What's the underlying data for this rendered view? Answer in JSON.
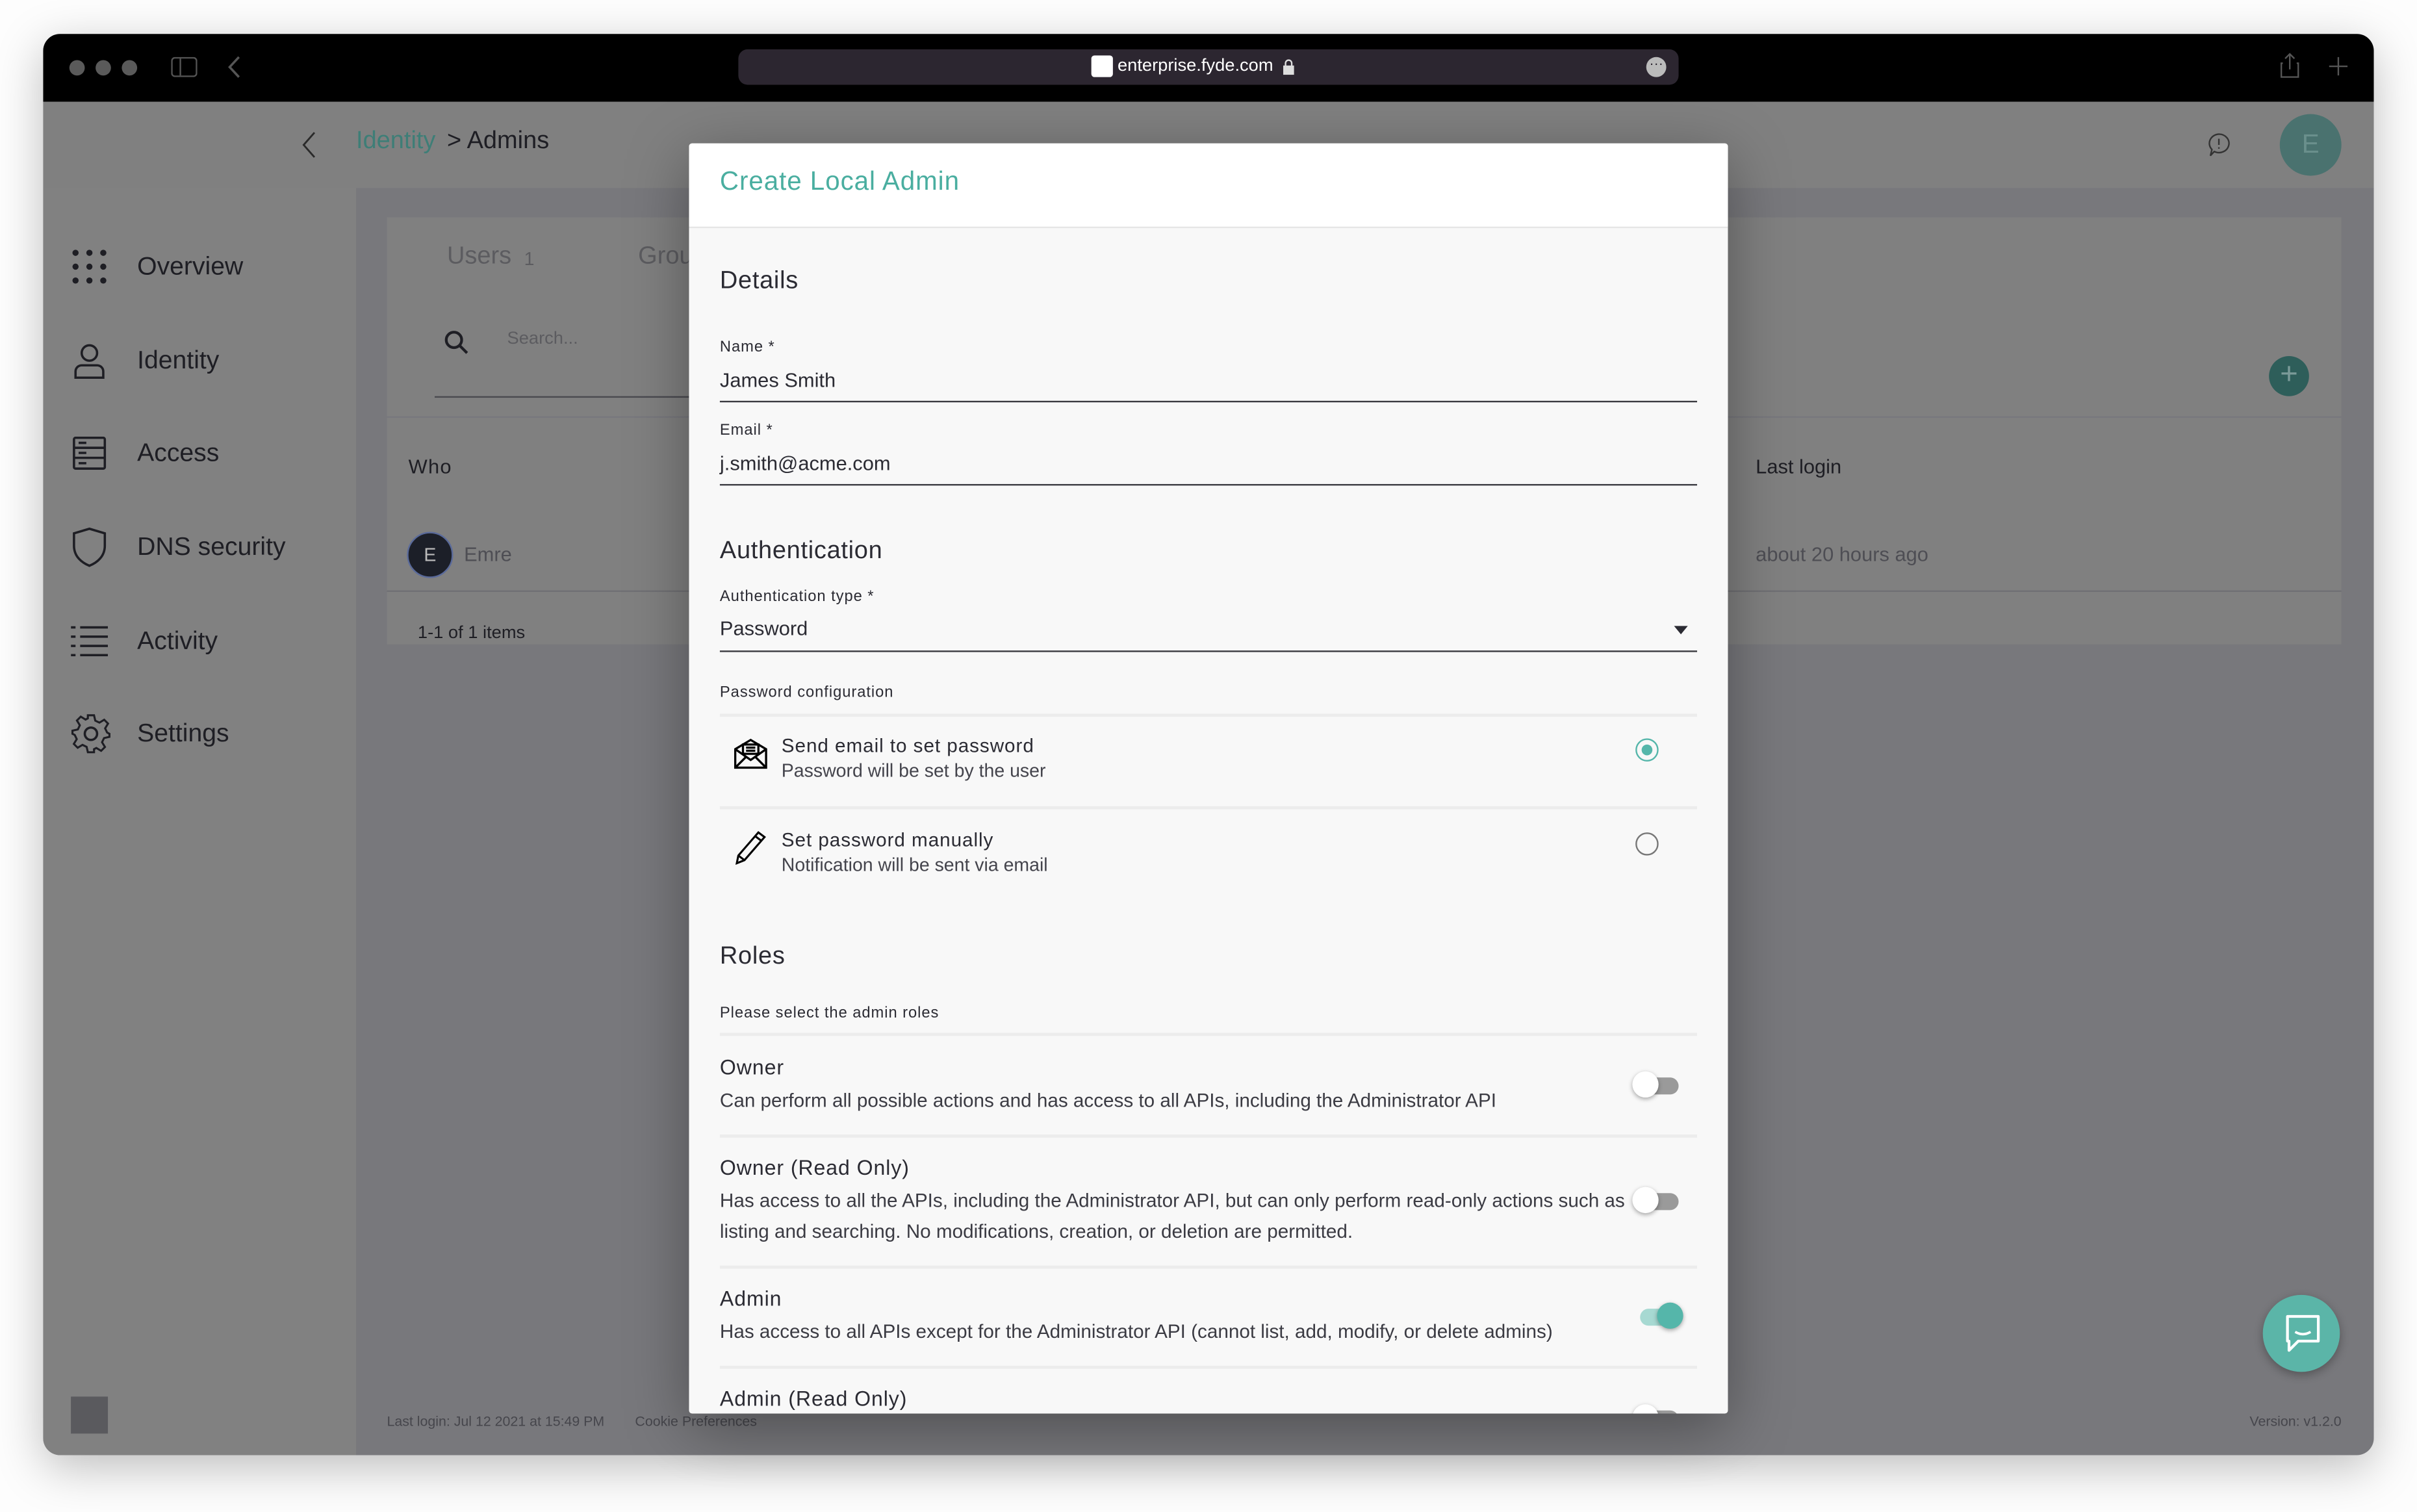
{
  "browser": {
    "url": "enterprise.fyde.com",
    "icons": [
      "traffic-lights",
      "sidebar-toggle-icon",
      "back-chevron-icon",
      "lock-icon",
      "more-icon",
      "share-icon",
      "new-tab-icon"
    ]
  },
  "header": {
    "breadcrumb_parent": "Identity",
    "breadcrumb_current": "> Admins",
    "avatar_initial": "E"
  },
  "sidebar": {
    "items": [
      {
        "label": "Overview",
        "icon": "grid-icon"
      },
      {
        "label": "Identity",
        "icon": "user-icon"
      },
      {
        "label": "Access",
        "icon": "server-icon"
      },
      {
        "label": "DNS security",
        "icon": "shield-icon"
      },
      {
        "label": "Activity",
        "icon": "list-icon"
      },
      {
        "label": "Settings",
        "icon": "gear-icon"
      }
    ]
  },
  "main": {
    "tabs": [
      {
        "label": "Users",
        "count": "1"
      },
      {
        "label": "Grou"
      }
    ],
    "search_placeholder": "Search...",
    "columns": [
      "Who",
      "Last login"
    ],
    "rows": [
      {
        "initial": "E",
        "name": "Emre",
        "last_login": "about 20 hours ago"
      }
    ],
    "pagination": "1-1 of 1 items"
  },
  "footer": {
    "last_login": "Last login: Jul 12 2021 at 15:49 PM",
    "cookie": "Cookie Preferences",
    "version": "Version: v1.2.0"
  },
  "modal": {
    "title": "Create Local Admin",
    "details_heading": "Details",
    "name_label": "Name *",
    "name_value": "James Smith",
    "email_label": "Email *",
    "email_value": "j.smith@acme.com",
    "auth_heading": "Authentication",
    "auth_type_label": "Authentication type *",
    "auth_type_value": "Password",
    "password_config_label": "Password configuration",
    "password_options": [
      {
        "title": "Send email to set password",
        "subtitle": "Password will be set by the user",
        "selected": true,
        "icon": "envelope-icon"
      },
      {
        "title": "Set password manually",
        "subtitle": "Notification will be sent via email",
        "selected": false,
        "icon": "pencil-icon"
      }
    ],
    "roles_heading": "Roles",
    "roles_label": "Please select the admin roles",
    "roles": [
      {
        "title": "Owner",
        "desc": "Can perform all possible actions and has access to all APIs, including the Administrator API",
        "enabled": false
      },
      {
        "title": "Owner (Read Only)",
        "desc": "Has access to all the APIs, including the Administrator API, but can only perform read-only actions such as listing and searching. No modifications, creation, or deletion are permitted.",
        "enabled": false
      },
      {
        "title": "Admin",
        "desc": "Has access to all APIs except for the Administrator API (cannot list, add, modify, or delete admins)",
        "enabled": true
      },
      {
        "title": "Admin (Read Only)",
        "enabled": false
      }
    ]
  },
  "colors": {
    "accent": "#55b6aa",
    "overlay": "#808080",
    "titlebar": "#000000"
  }
}
